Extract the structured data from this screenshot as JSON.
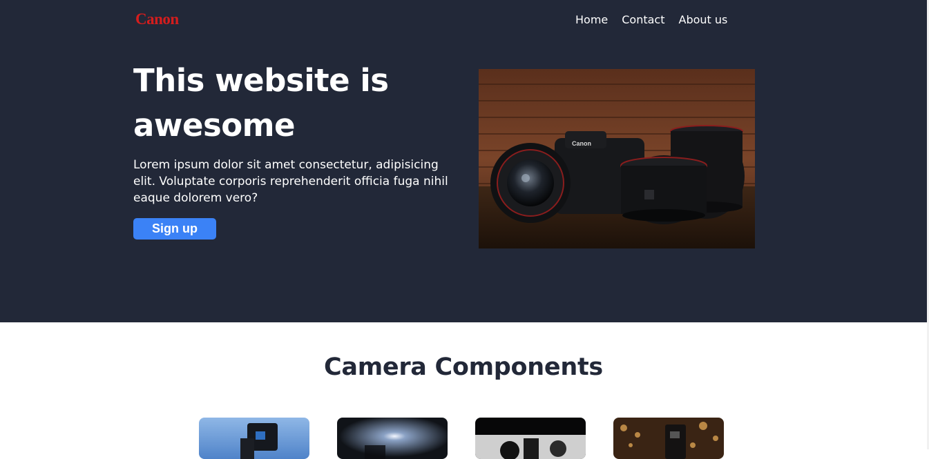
{
  "brand": {
    "logo_text": "Canon",
    "color": "#d51d1d"
  },
  "nav": {
    "items": [
      "Home",
      "Contact",
      "About us"
    ]
  },
  "hero": {
    "headline": "This website is awesome",
    "body": "Lorem ipsum dolor sit amet consectetur, adipisicing elit. Voluptate corporis reprehenderit officia fuga nihil eaque dolorem vero?",
    "cta_label": "Sign up",
    "background_color": "#222838",
    "cta_color": "#3b82f6",
    "image_subject": "canon-camera-and-lenses-photo"
  },
  "components": {
    "title": "Camera Components",
    "cards": [
      {
        "image_subject": "camera-rig-sky-photo"
      },
      {
        "image_subject": "lens-light-photo"
      },
      {
        "image_subject": "camera-closeup-photo"
      },
      {
        "image_subject": "camera-bokeh-photo"
      }
    ]
  }
}
